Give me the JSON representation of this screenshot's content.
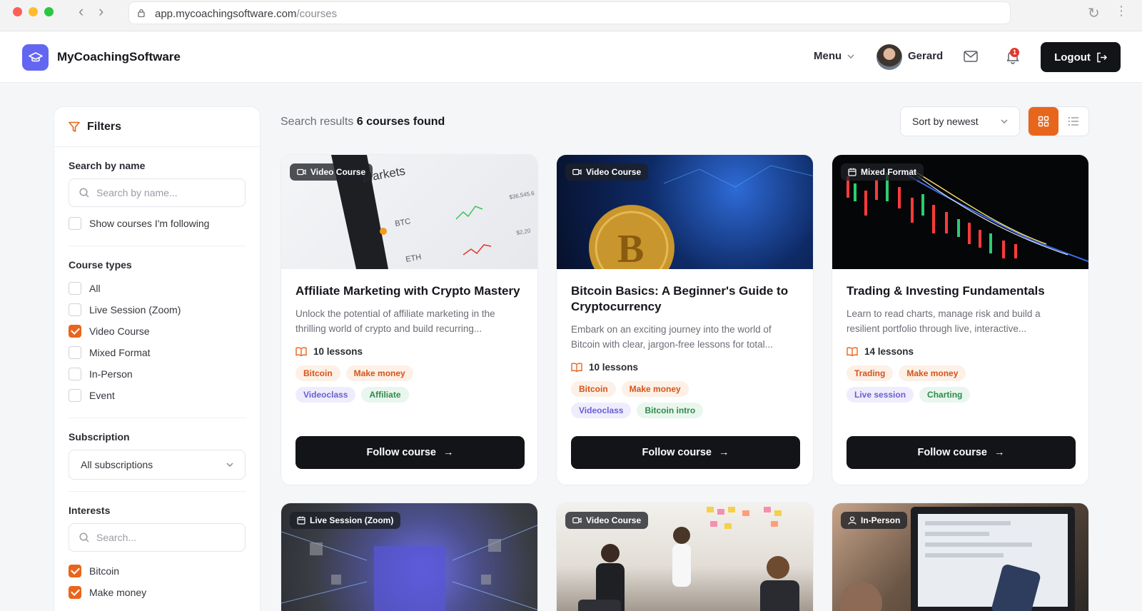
{
  "browser": {
    "url_host": "app.mycoachingsoftware.com",
    "url_path": "/courses"
  },
  "header": {
    "brand": "MyCoachingSoftware",
    "menu_label": "Menu",
    "user_name": "Gerard",
    "notification_count": "1",
    "logout_label": "Logout"
  },
  "filters": {
    "title": "Filters",
    "search_label": "Search by name",
    "search_placeholder": "Search by name...",
    "following_label": "Show courses I'm following",
    "course_types_label": "Course types",
    "course_types": [
      {
        "label": "All",
        "checked": false
      },
      {
        "label": "Live Session (Zoom)",
        "checked": false
      },
      {
        "label": "Video Course",
        "checked": true
      },
      {
        "label": "Mixed Format",
        "checked": false
      },
      {
        "label": "In-Person",
        "checked": false
      },
      {
        "label": "Event",
        "checked": false
      }
    ],
    "subscription_label": "Subscription",
    "subscription_value": "All subscriptions",
    "interests_label": "Interests",
    "interests_placeholder": "Search...",
    "interests": [
      {
        "label": "Bitcoin",
        "checked": true
      },
      {
        "label": "Make money",
        "checked": true
      }
    ]
  },
  "results": {
    "prefix": "Search results",
    "count_text": "6 courses found",
    "sort_label": "Sort by newest"
  },
  "courses": [
    {
      "format": "Video Course",
      "title": "Affiliate Marketing with Crypto Mastery",
      "description": "Unlock the potential of affiliate marketing in the thrilling world of crypto and build recurring...",
      "lessons": "10 lessons",
      "tags": [
        {
          "label": "Bitcoin",
          "color": "orange"
        },
        {
          "label": "Make money",
          "color": "orange"
        },
        {
          "label": "Videoclass",
          "color": "purple"
        },
        {
          "label": "Affiliate",
          "color": "green"
        }
      ],
      "button": "Follow course"
    },
    {
      "format": "Video Course",
      "title": "Bitcoin Basics: A Beginner's Guide to Cryptocurrency",
      "description": "Embark on an exciting journey into the world of Bitcoin with clear, jargon-free lessons for total...",
      "lessons": "10 lessons",
      "tags": [
        {
          "label": "Bitcoin",
          "color": "orange"
        },
        {
          "label": "Make money",
          "color": "orange"
        },
        {
          "label": "Videoclass",
          "color": "purple"
        },
        {
          "label": "Bitcoin intro",
          "color": "green"
        }
      ],
      "button": "Follow course"
    },
    {
      "format": "Mixed Format",
      "title": "Trading & Investing Fundamentals",
      "description": "Learn to read charts, manage risk and build a resilient portfolio through live, interactive...",
      "lessons": "14 lessons",
      "tags": [
        {
          "label": "Trading",
          "color": "orange"
        },
        {
          "label": "Make money",
          "color": "orange"
        },
        {
          "label": "Live session",
          "color": "purple"
        },
        {
          "label": "Charting",
          "color": "green"
        }
      ],
      "button": "Follow course"
    },
    {
      "format": "Live Session (Zoom)"
    },
    {
      "format": "Video Course"
    },
    {
      "format": "In-Person"
    }
  ],
  "colors": {
    "accent": "#e8661c",
    "primary_dark": "#121418",
    "logo": "#6366f1"
  },
  "img_text": {
    "markets": "Markets",
    "btc": "BTC",
    "eth": "ETH",
    "price1": "$36,545.6",
    "price2": "$2,20"
  }
}
